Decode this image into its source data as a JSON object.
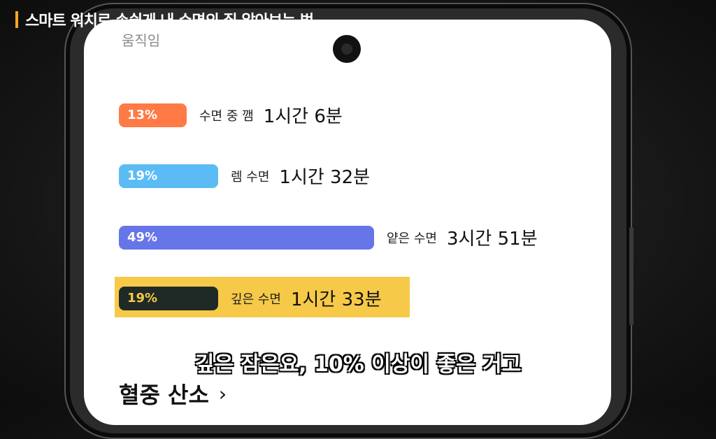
{
  "video": {
    "title": "스마트 워치로 손쉽게 내 수면의 질 알아보는 법",
    "subtitle": "깊은 잠은요, 10% 이상이 좋은 거고"
  },
  "screen": {
    "section_label": "움직임",
    "stages": [
      {
        "percent": "13%",
        "label": "수면 중 깸",
        "duration": "1시간 6분",
        "fraction": 0.13,
        "color": "#ff7a45"
      },
      {
        "percent": "19%",
        "label": "렘 수면",
        "duration": "1시간 32분",
        "fraction": 0.19,
        "color": "#5bbcf5"
      },
      {
        "percent": "49%",
        "label": "얕은 수면",
        "duration": "3시간 51분",
        "fraction": 0.49,
        "color": "#6675e8"
      },
      {
        "percent": "19%",
        "label": "깊은 수면",
        "duration": "1시간 33분",
        "fraction": 0.19,
        "color": "#1f2a26",
        "text_color": "#f7c948",
        "highlighted": true
      }
    ],
    "health_link": {
      "label": "혈중 산소",
      "icon": "chevron-right-icon"
    }
  }
}
